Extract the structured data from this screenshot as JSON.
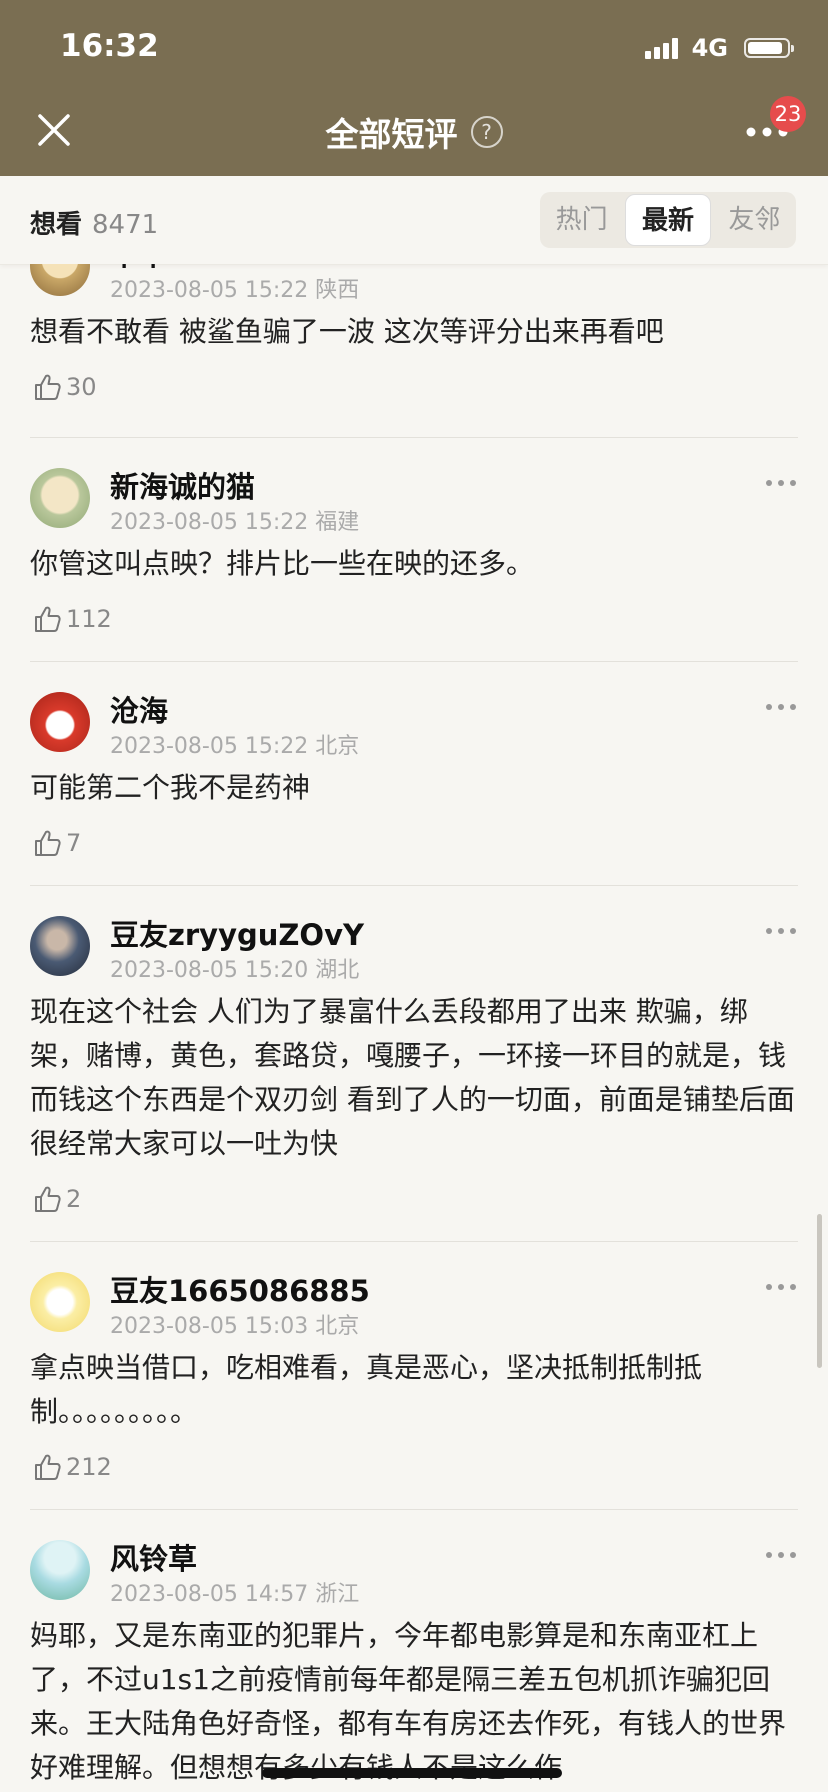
{
  "status_bar": {
    "time": "16:32",
    "network": "4G"
  },
  "header": {
    "title": "全部短评",
    "help_icon": "question-circle-icon",
    "badge": "23"
  },
  "filter": {
    "label": "想看",
    "count": "8471",
    "tabs": [
      "热门",
      "最新",
      "友邻"
    ],
    "active_tab": "最新"
  },
  "comments": [
    {
      "user": "卞卞",
      "date": "2023-08-05 15:22",
      "location": "陕西",
      "text": "想看不敢看 被鲨鱼骗了一波 这次等评分出来再看吧",
      "likes": "30"
    },
    {
      "user": "新海诚的猫",
      "date": "2023-08-05 15:22",
      "location": "福建",
      "text": "你管这叫点映？排片比一些在映的还多。",
      "likes": "112"
    },
    {
      "user": "沧海",
      "date": "2023-08-05 15:22",
      "location": "北京",
      "text": "可能第二个我不是药神",
      "likes": "7"
    },
    {
      "user": "豆友zryyguZOvY",
      "date": "2023-08-05 15:20",
      "location": "湖北",
      "text": "现在这个社会 人们为了暴富什么丢段都用了出来 欺骗，绑架，赌博，黄色，套路贷，嘎腰子，一环接一环目的就是，钱  而钱这个东西是个双刃剑 看到了人的一切面，前面是铺垫后面很经常大家可以一吐为快",
      "likes": "2"
    },
    {
      "user": "豆友1665086885",
      "date": "2023-08-05 15:03",
      "location": "北京",
      "text": "拿点映当借口，吃相难看，真是恶心，坚决抵制抵制抵制。。。。。。。。。",
      "likes": "212"
    },
    {
      "user": "风铃草",
      "date": "2023-08-05 14:57",
      "location": "浙江",
      "text": "妈耶，又是东南亚的犯罪片，今年都电影算是和东南亚杠上了，不过u1s1之前疫情前每年都是隔三差五包机抓诈骗犯回来。王大陆角色好奇怪，都有车有房还去作死，有钱人的世界好难理解。但想想有多少有钱人不是这么作",
      "likes": ""
    }
  ]
}
